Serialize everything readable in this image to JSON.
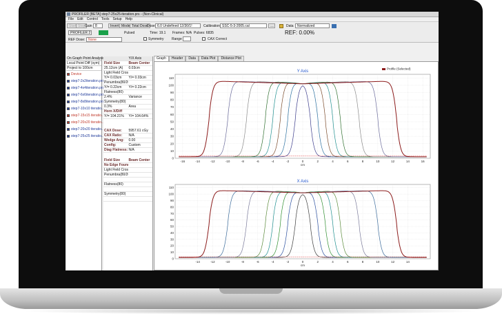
{
  "window": {
    "title": "PROFILER [BETA] step7-25x25-iteration.prs - (Non-Clinical)"
  },
  "menu": [
    "File",
    "Edit",
    "Control",
    "Tools",
    "Setup",
    "Help"
  ],
  "toolbar": {
    "start": "Start",
    "stop": "Stop",
    "gain_label": "Gain",
    "gain_value": "8",
    "invert": "Invert",
    "mode": "Mode",
    "total_dose": "Total Dose",
    "dose_label": "Dose",
    "dose_value": "6.0 Undefined 12/30/1!",
    "calibration_label": "Calibration",
    "calibration_value": "SSC-5-3-2005.cal",
    "data_label": "Data",
    "data_value": "Normalized",
    "device": "PROFILER 2",
    "pulsed": "Pulsed",
    "time": "Time: 19.1",
    "frames": "Frames: N/A",
    "pulses": "Pulses: 6835",
    "ref_label": "REF: 0.00%",
    "ref_dose_label": "REF Dose:",
    "ref_dose_value": "None",
    "symmetry": "Symmetry",
    "range": "Range",
    "cax_correct": "CAX Correct"
  },
  "left": {
    "header": "On Graph Point Analysis",
    "local": "Local Point Diff (sym)",
    "project": "Project to 100cm",
    "items": [
      {
        "label": "Device",
        "color": "#c0392b"
      },
      {
        "label": "step7-2x2iteration.prs",
        "color": "#1f3a9a"
      },
      {
        "label": "step7-4x4iteration.prs",
        "color": "#1f3a9a"
      },
      {
        "label": "step7-6x6iteration.prs",
        "color": "#1f3a9a"
      },
      {
        "label": "step7-8x8iteration.prs",
        "color": "#1f3a9a"
      },
      {
        "label": "step7-10x10 iteratio...",
        "color": "#1f3a9a"
      },
      {
        "label": "step7-15x15 iteratio...",
        "color": "#c0392b"
      },
      {
        "label": "step7-20x20 iteratio...",
        "color": "#c0392b"
      },
      {
        "label": "step7-20x20 iteratio...",
        "color": "#1f3a9a"
      },
      {
        "label": "step7-25x25 iteratio...",
        "color": "#1f3a9a"
      }
    ]
  },
  "mid": {
    "tab_y": "Y/X Axis",
    "rows1": [
      [
        "Field Size",
        "Beam Center"
      ],
      [
        "25.12cm (A)",
        "0.03cm"
      ],
      [
        "Light Field Cross (25)",
        ""
      ],
      [
        "Y/= 0.03cm",
        "Y/= 0.03cm"
      ],
      [
        "Penumbra(80/20)",
        ""
      ],
      [
        "Y/= 0.22cm",
        "Y/= 0.22cm"
      ],
      [
        "Flatness(80)",
        ""
      ],
      [
        "2.4%",
        "Variance"
      ],
      [
        "Symmetry(80)",
        ""
      ],
      [
        "0.3%",
        "Area"
      ],
      [
        "Horn X/Diff",
        ""
      ],
      [
        "Y/= 104.21%",
        "Y/= 104.64%"
      ]
    ],
    "rows2": [
      [
        "CAX Dose:",
        "5957.61 cGy"
      ],
      [
        "CAX Ratio:",
        "N/A"
      ],
      [
        "Wedge Ang:",
        "0.00"
      ],
      [
        "Config:",
        "Custom"
      ],
      [
        "Diag Flatness:",
        "N/A"
      ]
    ],
    "rows3": [
      [
        "Field Size",
        "Beam Center"
      ],
      [
        "No Edge Found",
        ""
      ],
      [
        "Light Field Cross (25)",
        ""
      ],
      [
        "Penumbra(80/20)",
        ""
      ],
      [
        "",
        ""
      ],
      [
        "Flatness(80)",
        ""
      ],
      [
        "",
        ""
      ],
      [
        "Symmetry(80)",
        ""
      ],
      [
        "",
        ""
      ]
    ]
  },
  "tabs": [
    "Graph",
    "Header",
    "Data",
    "Data Plot",
    "Distance Plot"
  ],
  "chart_data": [
    {
      "type": "line",
      "title": "Y Axis",
      "legend": "Profile (Selected)",
      "xlabel": "cm",
      "ylabel": "",
      "xlim": [
        -17,
        17
      ],
      "ylim": [
        0,
        115
      ],
      "x_ticks": [
        -16,
        -14,
        -12,
        -10,
        -8,
        -6,
        -4,
        -2,
        0,
        2,
        4,
        6,
        8,
        10,
        12,
        14,
        16
      ],
      "y_ticks": [
        0,
        10,
        20,
        30,
        40,
        50,
        60,
        70,
        80,
        90,
        100,
        110
      ],
      "series": [
        {
          "half_width": 1,
          "color": "#3a3a8a"
        },
        {
          "half_width": 2,
          "color": "#2a6f9f"
        },
        {
          "half_width": 3,
          "color": "#7a4a2a"
        },
        {
          "half_width": 4,
          "color": "#1f8f8f"
        },
        {
          "half_width": 5,
          "color": "#2f6f2f"
        },
        {
          "half_width": 7.5,
          "color": "#8a8a8a"
        },
        {
          "half_width": 10,
          "color": "#6a6a9a"
        },
        {
          "half_width": 12.5,
          "color": "#8b1a1a"
        }
      ]
    },
    {
      "type": "line",
      "title": "X Axis",
      "xlabel": "cm",
      "ylabel": "",
      "xlim": [
        -17,
        17
      ],
      "ylim": [
        0,
        115
      ],
      "x_ticks": [
        -14,
        -12,
        -10,
        -8,
        -6,
        -4,
        -2,
        0,
        2,
        4,
        6,
        8,
        10,
        12,
        14
      ],
      "y_ticks": [
        0,
        10,
        20,
        30,
        40,
        50,
        60,
        70,
        80,
        90,
        100,
        110
      ],
      "series": [
        {
          "half_width": 1,
          "color": "#3a3a3a"
        },
        {
          "half_width": 2,
          "color": "#2a4f9f"
        },
        {
          "half_width": 3,
          "color": "#2f8f2f"
        },
        {
          "half_width": 4,
          "color": "#1f8f8f"
        },
        {
          "half_width": 5,
          "color": "#5a8a3a"
        },
        {
          "half_width": 7.5,
          "color": "#7a7a9a"
        },
        {
          "half_width": 10,
          "color": "#3a6a9a"
        },
        {
          "half_width": 12.5,
          "color": "#8b1a1a"
        }
      ]
    }
  ]
}
